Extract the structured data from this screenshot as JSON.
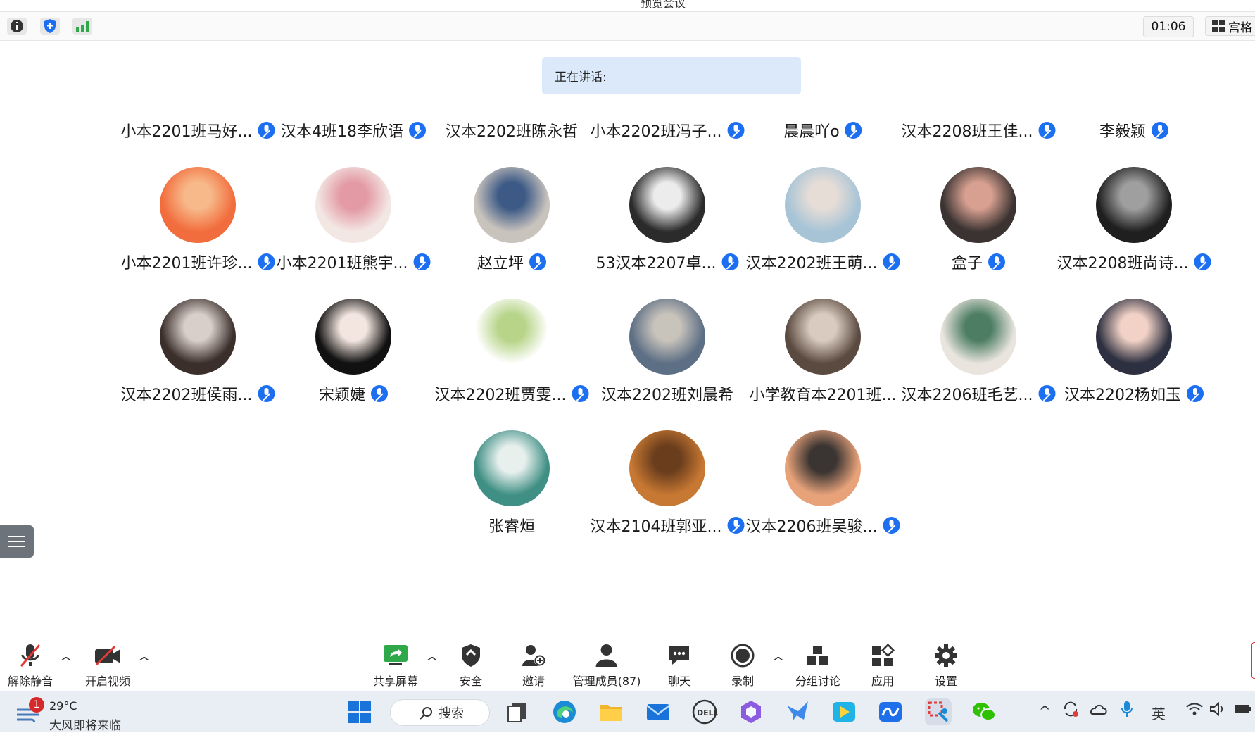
{
  "window": {
    "title": "预览会议"
  },
  "topbar": {
    "timer": "01:06",
    "view_label": "宫格"
  },
  "speaking": {
    "label": "正在讲话:"
  },
  "participants": [
    {
      "name": "小本2201班马好...",
      "mic": true,
      "avatar_colors": null
    },
    {
      "name": "汉本4班18李欣语",
      "mic": true,
      "avatar_colors": null
    },
    {
      "name": "汉本2202班陈永哲",
      "mic": false,
      "avatar_colors": null
    },
    {
      "name": "小本2202班冯子...",
      "mic": true,
      "avatar_colors": null
    },
    {
      "name": "晨晨吖o",
      "mic": true,
      "avatar_colors": null
    },
    {
      "name": "汉本2208班王佳...",
      "mic": true,
      "avatar_colors": null
    },
    {
      "name": "李毅颖",
      "mic": true,
      "avatar_colors": null
    },
    {
      "name": "小本2201班许珍...",
      "mic": true,
      "avatar_colors": [
        "#f26d3d",
        "#f7b98a"
      ]
    },
    {
      "name": "小本2201班熊宇...",
      "mic": true,
      "avatar_colors": [
        "#f3e7e4",
        "#e39aa4"
      ]
    },
    {
      "name": "赵立坪",
      "mic": true,
      "avatar_colors": [
        "#c9c3bd",
        "#3d5a86"
      ]
    },
    {
      "name": "53汉本2207卓...",
      "mic": true,
      "avatar_colors": [
        "#2b2b2b",
        "#ececec"
      ]
    },
    {
      "name": "汉本2202班王萌...",
      "mic": true,
      "avatar_colors": [
        "#a7c4d6",
        "#e7ddd7"
      ]
    },
    {
      "name": "盒子",
      "mic": true,
      "avatar_colors": [
        "#3a3331",
        "#d8a091"
      ]
    },
    {
      "name": "汉本2208班尚诗...",
      "mic": true,
      "avatar_colors": [
        "#1f1f1f",
        "#9f9f9f"
      ]
    },
    {
      "name": "汉本2202班侯雨...",
      "mic": true,
      "avatar_colors": [
        "#3b2f2b",
        "#d9cfca"
      ]
    },
    {
      "name": "宋颖婕",
      "mic": true,
      "avatar_colors": [
        "#111111",
        "#f3e6e0"
      ]
    },
    {
      "name": "汉本2202班贾雯...",
      "mic": true,
      "avatar_colors": [
        "#ffffff",
        "#b7d488"
      ]
    },
    {
      "name": "汉本2202班刘晨希",
      "mic": false,
      "avatar_colors": [
        "#5d6f84",
        "#c8c3bb"
      ]
    },
    {
      "name": "小学教育本2201班...",
      "mic": false,
      "avatar_colors": [
        "#5b4a40",
        "#d9cbbf"
      ]
    },
    {
      "name": "汉本2206班毛艺...",
      "mic": true,
      "avatar_colors": [
        "#e9e4de",
        "#4d7e63"
      ]
    },
    {
      "name": "汉本2202杨如玉",
      "mic": true,
      "avatar_colors": [
        "#2d3040",
        "#f2d2c6"
      ]
    },
    {
      "name": "张睿烜",
      "mic": false,
      "avatar_colors": [
        "#3f8f84",
        "#e8f0ee"
      ]
    },
    {
      "name": "汉本2104班郭亚...",
      "mic": true,
      "avatar_colors": [
        "#c77832",
        "#6a3d1d"
      ]
    },
    {
      "name": "汉本2206班吴骏...",
      "mic": true,
      "avatar_colors": [
        "#e7a27a",
        "#3a3432"
      ]
    }
  ],
  "toolbar": {
    "unmute": "解除静音",
    "start_video": "开启视频",
    "share_screen": "共享屏幕",
    "security": "安全",
    "invite": "邀请",
    "manage_members": "管理成员(87)",
    "chat": "聊天",
    "record": "录制",
    "breakout": "分组讨论",
    "apps": "应用",
    "settings": "设置"
  },
  "taskbar": {
    "weather_temp": "29°C",
    "weather_desc": "大风即将来临",
    "weather_badge": "1",
    "search": "搜索",
    "ime": "英"
  },
  "colors": {
    "accent": "#1d6ff2",
    "speaking_bg": "#dbe9fb",
    "share_green": "#2fa84a"
  }
}
